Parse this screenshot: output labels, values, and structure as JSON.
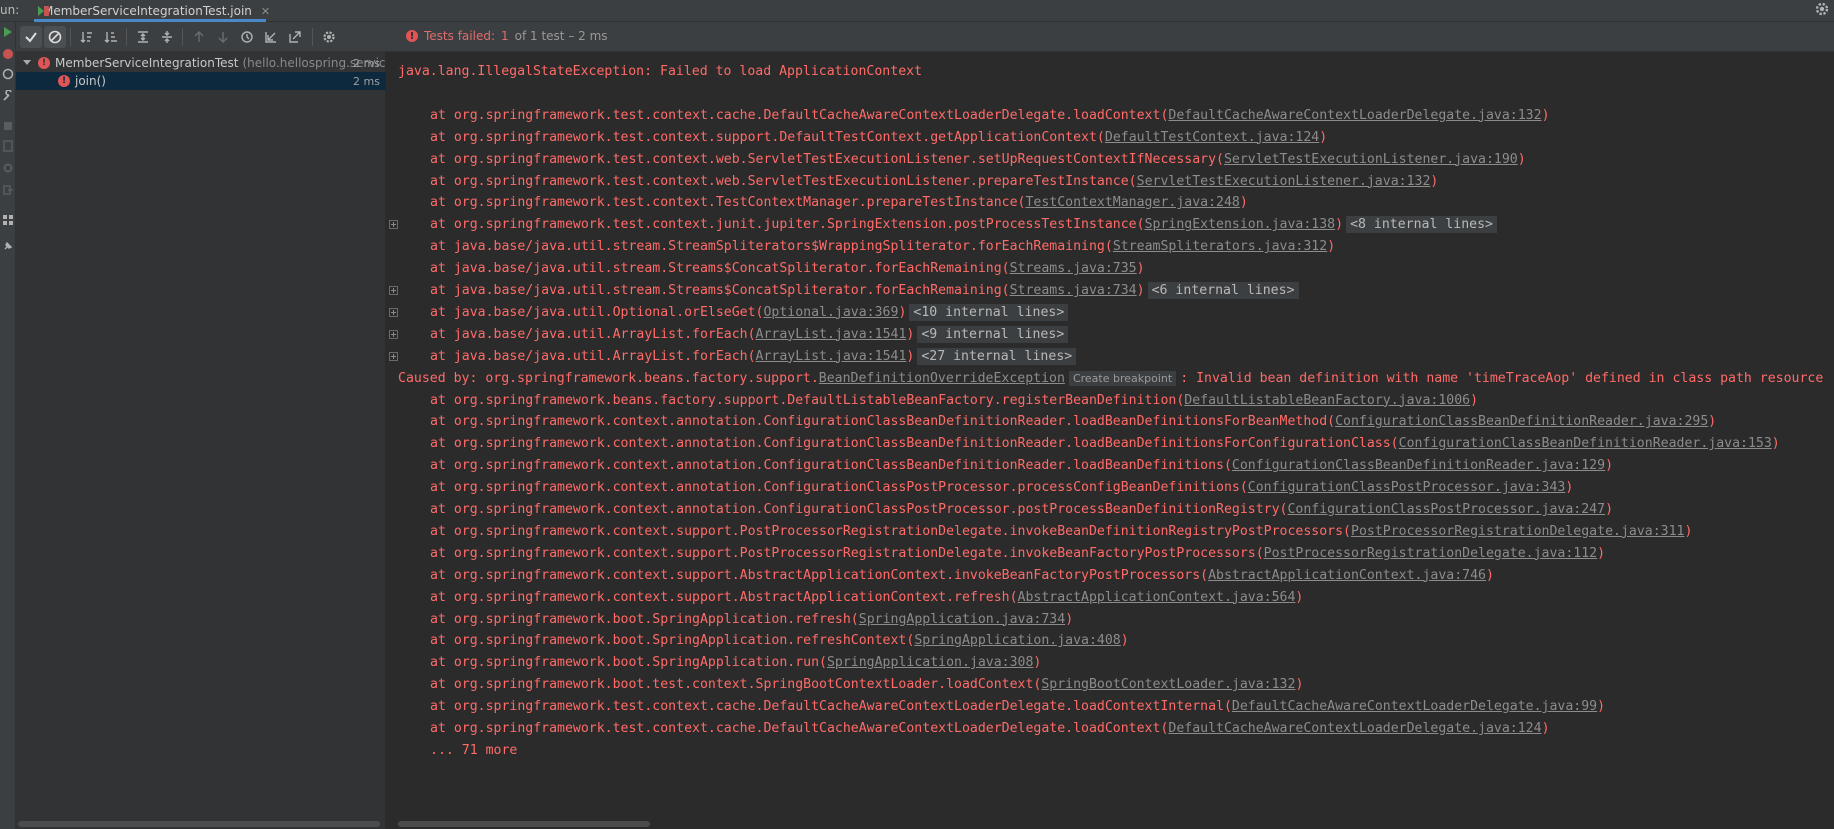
{
  "window": {
    "run_label": "un:",
    "tab_title": "MemberServiceIntegrationTest.join"
  },
  "colors": {
    "error_text": "#ff6b68",
    "link_text": "#8c8c8c",
    "background": "#2b2b2b",
    "selection": "#0d293e",
    "tab_underline": "#4a88c7"
  },
  "toolbar": {
    "buttons": [
      {
        "icon": "checkmark-icon",
        "active": true
      },
      {
        "icon": "stop-circle-icon",
        "active": true
      },
      {
        "icon": "sort-alpha-icon"
      },
      {
        "icon": "sort-duration-icon"
      },
      {
        "icon": "expand-all-icon"
      },
      {
        "icon": "collapse-all-icon"
      },
      {
        "icon": "arrow-up-icon"
      },
      {
        "icon": "arrow-down-icon"
      },
      {
        "icon": "history-clock-icon"
      },
      {
        "icon": "import-tests-icon"
      },
      {
        "icon": "export-tests-icon"
      },
      {
        "icon": "gear-icon"
      }
    ]
  },
  "status": {
    "failed_label": "Tests failed:",
    "count": "1",
    "rest": "of 1 test – 2 ms"
  },
  "tree": {
    "root": {
      "name": "MemberServiceIntegrationTest",
      "package": "(hello.hellospring.service",
      "time": "2 ms"
    },
    "child": {
      "name": "join()",
      "time": "2 ms"
    }
  },
  "console": {
    "lines": [
      {
        "kind": "head",
        "text": "java.lang.IllegalStateException: Failed to load ApplicationContext"
      },
      {
        "kind": "blank",
        "text": ""
      },
      {
        "kind": "at",
        "text": "at org.springframework.test.context.cache.DefaultCacheAwareContextLoaderDelegate.loadContext(",
        "link": "DefaultCacheAwareContextLoaderDelegate.java:132",
        "tail": ")"
      },
      {
        "kind": "at",
        "text": "at org.springframework.test.context.support.DefaultTestContext.getApplicationContext(",
        "link": "DefaultTestContext.java:124",
        "tail": ")"
      },
      {
        "kind": "at",
        "text": "at org.springframework.test.context.web.ServletTestExecutionListener.setUpRequestContextIfNecessary(",
        "link": "ServletTestExecutionListener.java:190",
        "tail": ")"
      },
      {
        "kind": "at",
        "text": "at org.springframework.test.context.web.ServletTestExecutionListener.prepareTestInstance(",
        "link": "ServletTestExecutionListener.java:132",
        "tail": ")"
      },
      {
        "kind": "at",
        "text": "at org.springframework.test.context.TestContextManager.prepareTestInstance(",
        "link": "TestContextManager.java:248",
        "tail": ")"
      },
      {
        "kind": "at",
        "fold": true,
        "text": "at org.springframework.test.context.junit.jupiter.SpringExtension.postProcessTestInstance(",
        "link": "SpringExtension.java:138",
        "tail": ")",
        "internal": "<8 internal lines>"
      },
      {
        "kind": "at",
        "text": "at java.base/java.util.stream.StreamSpliterators$WrappingSpliterator.forEachRemaining(",
        "link": "StreamSpliterators.java:312",
        "tail": ")"
      },
      {
        "kind": "at",
        "text": "at java.base/java.util.stream.Streams$ConcatSpliterator.forEachRemaining(",
        "link": "Streams.java:735",
        "tail": ")"
      },
      {
        "kind": "at",
        "fold": true,
        "text": "at java.base/java.util.stream.Streams$ConcatSpliterator.forEachRemaining(",
        "link": "Streams.java:734",
        "tail": ")",
        "internal": "<6 internal lines>"
      },
      {
        "kind": "at",
        "fold": true,
        "text": "at java.base/java.util.Optional.orElseGet(",
        "link": "Optional.java:369",
        "tail": ")",
        "internal": "<10 internal lines>"
      },
      {
        "kind": "at",
        "fold": true,
        "text": "at java.base/java.util.ArrayList.forEach(",
        "link": "ArrayList.java:1541",
        "tail": ")",
        "internal": "<9 internal lines>"
      },
      {
        "kind": "at",
        "fold": true,
        "text": "at java.base/java.util.ArrayList.forEach(",
        "link": "ArrayList.java:1541",
        "tail": ")",
        "internal": "<27 internal lines>"
      },
      {
        "kind": "caused",
        "text": "Caused by: org.springframework.beans.factory.support.",
        "link": "BeanDefinitionOverrideException",
        "tip": "Create breakpoint",
        "tail": ": Invalid bean definition with name 'timeTraceAop' defined in class path resource"
      },
      {
        "kind": "at",
        "text": "at org.springframework.beans.factory.support.DefaultListableBeanFactory.registerBeanDefinition(",
        "link": "DefaultListableBeanFactory.java:1006",
        "tail": ")"
      },
      {
        "kind": "at",
        "text": "at org.springframework.context.annotation.ConfigurationClassBeanDefinitionReader.loadBeanDefinitionsForBeanMethod(",
        "link": "ConfigurationClassBeanDefinitionReader.java:295",
        "tail": ")"
      },
      {
        "kind": "at",
        "text": "at org.springframework.context.annotation.ConfigurationClassBeanDefinitionReader.loadBeanDefinitionsForConfigurationClass(",
        "link": "ConfigurationClassBeanDefinitionReader.java:153",
        "tail": ")"
      },
      {
        "kind": "at",
        "text": "at org.springframework.context.annotation.ConfigurationClassBeanDefinitionReader.loadBeanDefinitions(",
        "link": "ConfigurationClassBeanDefinitionReader.java:129",
        "tail": ")"
      },
      {
        "kind": "at",
        "text": "at org.springframework.context.annotation.ConfigurationClassPostProcessor.processConfigBeanDefinitions(",
        "link": "ConfigurationClassPostProcessor.java:343",
        "tail": ")"
      },
      {
        "kind": "at",
        "text": "at org.springframework.context.annotation.ConfigurationClassPostProcessor.postProcessBeanDefinitionRegistry(",
        "link": "ConfigurationClassPostProcessor.java:247",
        "tail": ")"
      },
      {
        "kind": "at",
        "text": "at org.springframework.context.support.PostProcessorRegistrationDelegate.invokeBeanDefinitionRegistryPostProcessors(",
        "link": "PostProcessorRegistrationDelegate.java:311",
        "tail": ")"
      },
      {
        "kind": "at",
        "text": "at org.springframework.context.support.PostProcessorRegistrationDelegate.invokeBeanFactoryPostProcessors(",
        "link": "PostProcessorRegistrationDelegate.java:112",
        "tail": ")"
      },
      {
        "kind": "at",
        "text": "at org.springframework.context.support.AbstractApplicationContext.invokeBeanFactoryPostProcessors(",
        "link": "AbstractApplicationContext.java:746",
        "tail": ")"
      },
      {
        "kind": "at",
        "text": "at org.springframework.context.support.AbstractApplicationContext.refresh(",
        "link": "AbstractApplicationContext.java:564",
        "tail": ")"
      },
      {
        "kind": "at",
        "text": "at org.springframework.boot.SpringApplication.refresh(",
        "link": "SpringApplication.java:734",
        "tail": ")"
      },
      {
        "kind": "at",
        "text": "at org.springframework.boot.SpringApplication.refreshContext(",
        "link": "SpringApplication.java:408",
        "tail": ")"
      },
      {
        "kind": "at",
        "text": "at org.springframework.boot.SpringApplication.run(",
        "link": "SpringApplication.java:308",
        "tail": ")"
      },
      {
        "kind": "at",
        "text": "at org.springframework.boot.test.context.SpringBootContextLoader.loadContext(",
        "link": "SpringBootContextLoader.java:132",
        "tail": ")"
      },
      {
        "kind": "at",
        "text": "at org.springframework.test.context.cache.DefaultCacheAwareContextLoaderDelegate.loadContextInternal(",
        "link": "DefaultCacheAwareContextLoaderDelegate.java:99",
        "tail": ")"
      },
      {
        "kind": "at",
        "text": "at org.springframework.test.context.cache.DefaultCacheAwareContextLoaderDelegate.loadContext(",
        "link": "DefaultCacheAwareContextLoaderDelegate.java:124",
        "tail": ")"
      },
      {
        "kind": "at",
        "text": "... 71 more"
      }
    ]
  }
}
